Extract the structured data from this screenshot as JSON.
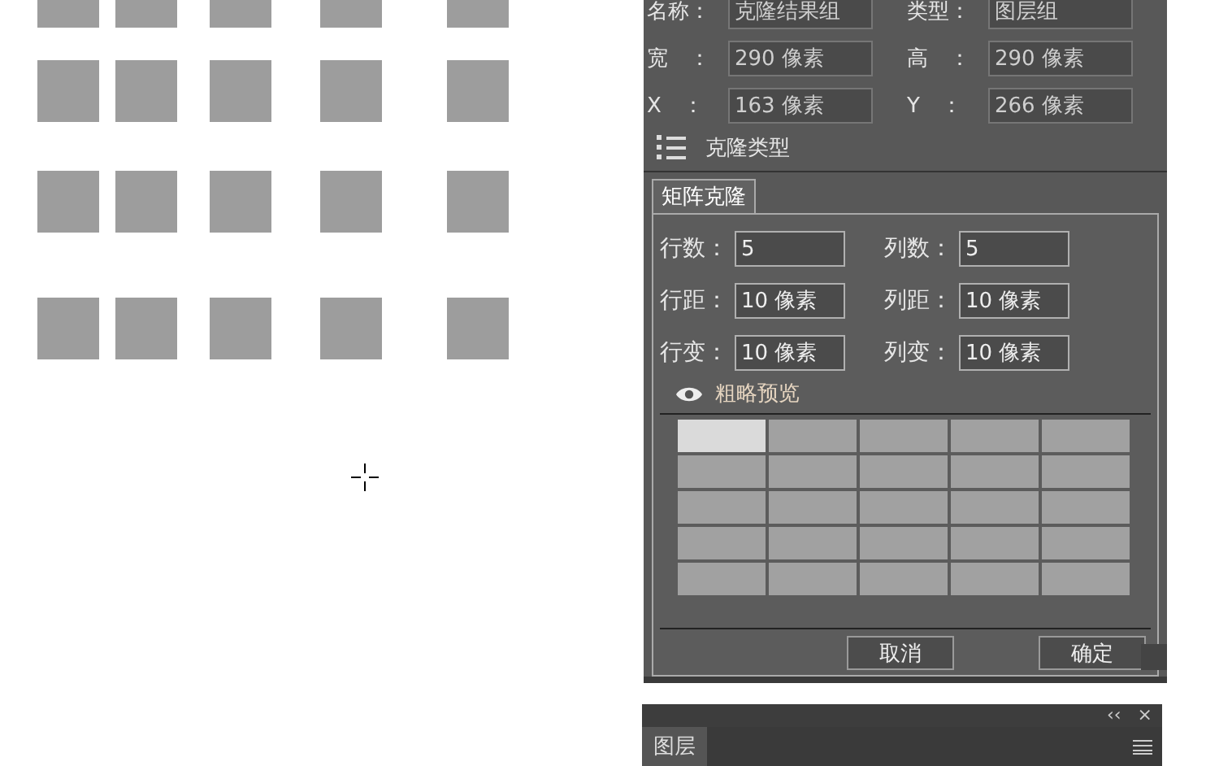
{
  "properties": [
    {
      "label": "名称：",
      "value": "克隆结果组"
    },
    {
      "label": "类型：",
      "value": "图层组"
    },
    {
      "label": "宽　：",
      "value": "290 像素"
    },
    {
      "label": "高　：",
      "value": "290 像素"
    },
    {
      "label": "X　：",
      "value": "163 像素"
    },
    {
      "label": "Y　：",
      "value": "266 像素"
    }
  ],
  "clone_type": {
    "title": "克隆类型"
  },
  "tabs": [
    {
      "label": "矩阵克隆",
      "selected": true
    }
  ],
  "matrix_fields": [
    {
      "label": "行数：",
      "value": "5"
    },
    {
      "label": "列数：",
      "value": "5"
    },
    {
      "label": "行距：",
      "value": "10 像素"
    },
    {
      "label": "列距：",
      "value": "10 像素"
    },
    {
      "label": "行变：",
      "value": "10 像素"
    },
    {
      "label": "列变：",
      "value": "10 像素"
    }
  ],
  "preview": {
    "title": "粗略预览",
    "rows": [
      [
        {
          "selected": true
        },
        {
          "selected": false
        },
        {
          "selected": false
        },
        {
          "selected": false
        },
        {
          "selected": false
        }
      ],
      [
        {
          "selected": false
        },
        {
          "selected": false
        },
        {
          "selected": false
        },
        {
          "selected": false
        },
        {
          "selected": false
        }
      ],
      [
        {
          "selected": false
        },
        {
          "selected": false
        },
        {
          "selected": false
        },
        {
          "selected": false
        },
        {
          "selected": false
        }
      ],
      [
        {
          "selected": false
        },
        {
          "selected": false
        },
        {
          "selected": false
        },
        {
          "selected": false
        },
        {
          "selected": false
        }
      ],
      [
        {
          "selected": false
        },
        {
          "selected": false
        },
        {
          "selected": false
        },
        {
          "selected": false
        },
        {
          "selected": false
        }
      ]
    ]
  },
  "buttons": [
    "取消",
    "确定"
  ],
  "layers_panel": {
    "collapse": "‹‹",
    "close": "×",
    "tabs": [
      {
        "label": "图层",
        "selected": true
      }
    ]
  }
}
